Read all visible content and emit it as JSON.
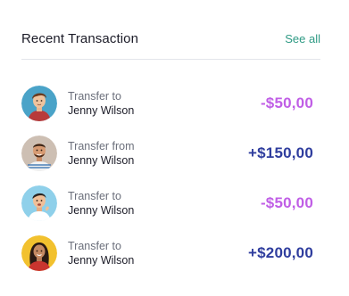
{
  "header": {
    "title": "Recent Transaction",
    "see_all": "See all"
  },
  "colors": {
    "accent_green": "#2e9a84",
    "negative_amount": "#c05ee6",
    "positive_amount": "#2f3d9e"
  },
  "transactions": [
    {
      "direction": "Transfer to",
      "name": "Jenny Wilson",
      "amount": "-$50,00",
      "type": "negative",
      "avatar_bg": "#4aa3c8"
    },
    {
      "direction": "Transfer from",
      "name": "Jenny Wilson",
      "amount": "+$150,00",
      "type": "positive",
      "avatar_bg": "#cdbfb3"
    },
    {
      "direction": "Transfer to",
      "name": "Jenny Wilson",
      "amount": "-$50,00",
      "type": "negative",
      "avatar_bg": "#8fd0ea"
    },
    {
      "direction": "Transfer to",
      "name": "Jenny Wilson",
      "amount": "+$200,00",
      "type": "positive",
      "avatar_bg": "#f2c12e"
    }
  ]
}
